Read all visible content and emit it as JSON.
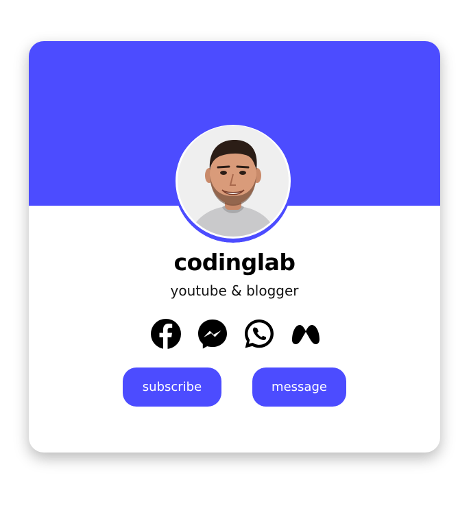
{
  "theme": {
    "accent": "#4c4cff",
    "card_bg": "#ffffff",
    "text_color": "#000000"
  },
  "profile": {
    "name": "codinglab",
    "role": "youtube & blogger",
    "avatar_icon": "person-avatar"
  },
  "socials": [
    {
      "name": "facebook",
      "icon": "facebook-icon"
    },
    {
      "name": "messenger",
      "icon": "messenger-icon"
    },
    {
      "name": "whatsapp",
      "icon": "whatsapp-icon"
    },
    {
      "name": "meta",
      "icon": "meta-icon"
    }
  ],
  "buttons": {
    "subscribe_label": "subscribe",
    "message_label": "message"
  }
}
